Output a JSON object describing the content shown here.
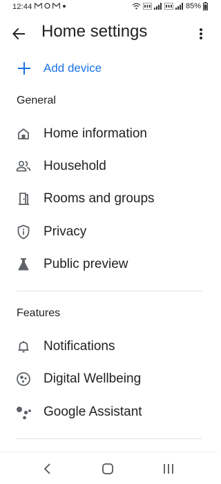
{
  "status_bar": {
    "time": "12:44",
    "battery": "85%"
  },
  "app_bar": {
    "title": "Home settings"
  },
  "add_device": {
    "label": "Add device"
  },
  "sections": {
    "general": {
      "header": "General",
      "items": [
        {
          "label": "Home information",
          "icon": "home-icon"
        },
        {
          "label": "Household",
          "icon": "people-icon"
        },
        {
          "label": "Rooms and groups",
          "icon": "door-icon"
        },
        {
          "label": "Privacy",
          "icon": "shield-icon"
        },
        {
          "label": "Public preview",
          "icon": "flask-icon"
        }
      ]
    },
    "features": {
      "header": "Features",
      "items": [
        {
          "label": "Notifications",
          "icon": "bell-icon"
        },
        {
          "label": "Digital Wellbeing",
          "icon": "wellbeing-icon"
        },
        {
          "label": "Google Assistant",
          "icon": "assistant-icon"
        }
      ]
    }
  },
  "colors": {
    "accent": "#1a73e8",
    "text": "#202124",
    "icon": "#5f6368",
    "divider": "#e0e0e0"
  }
}
